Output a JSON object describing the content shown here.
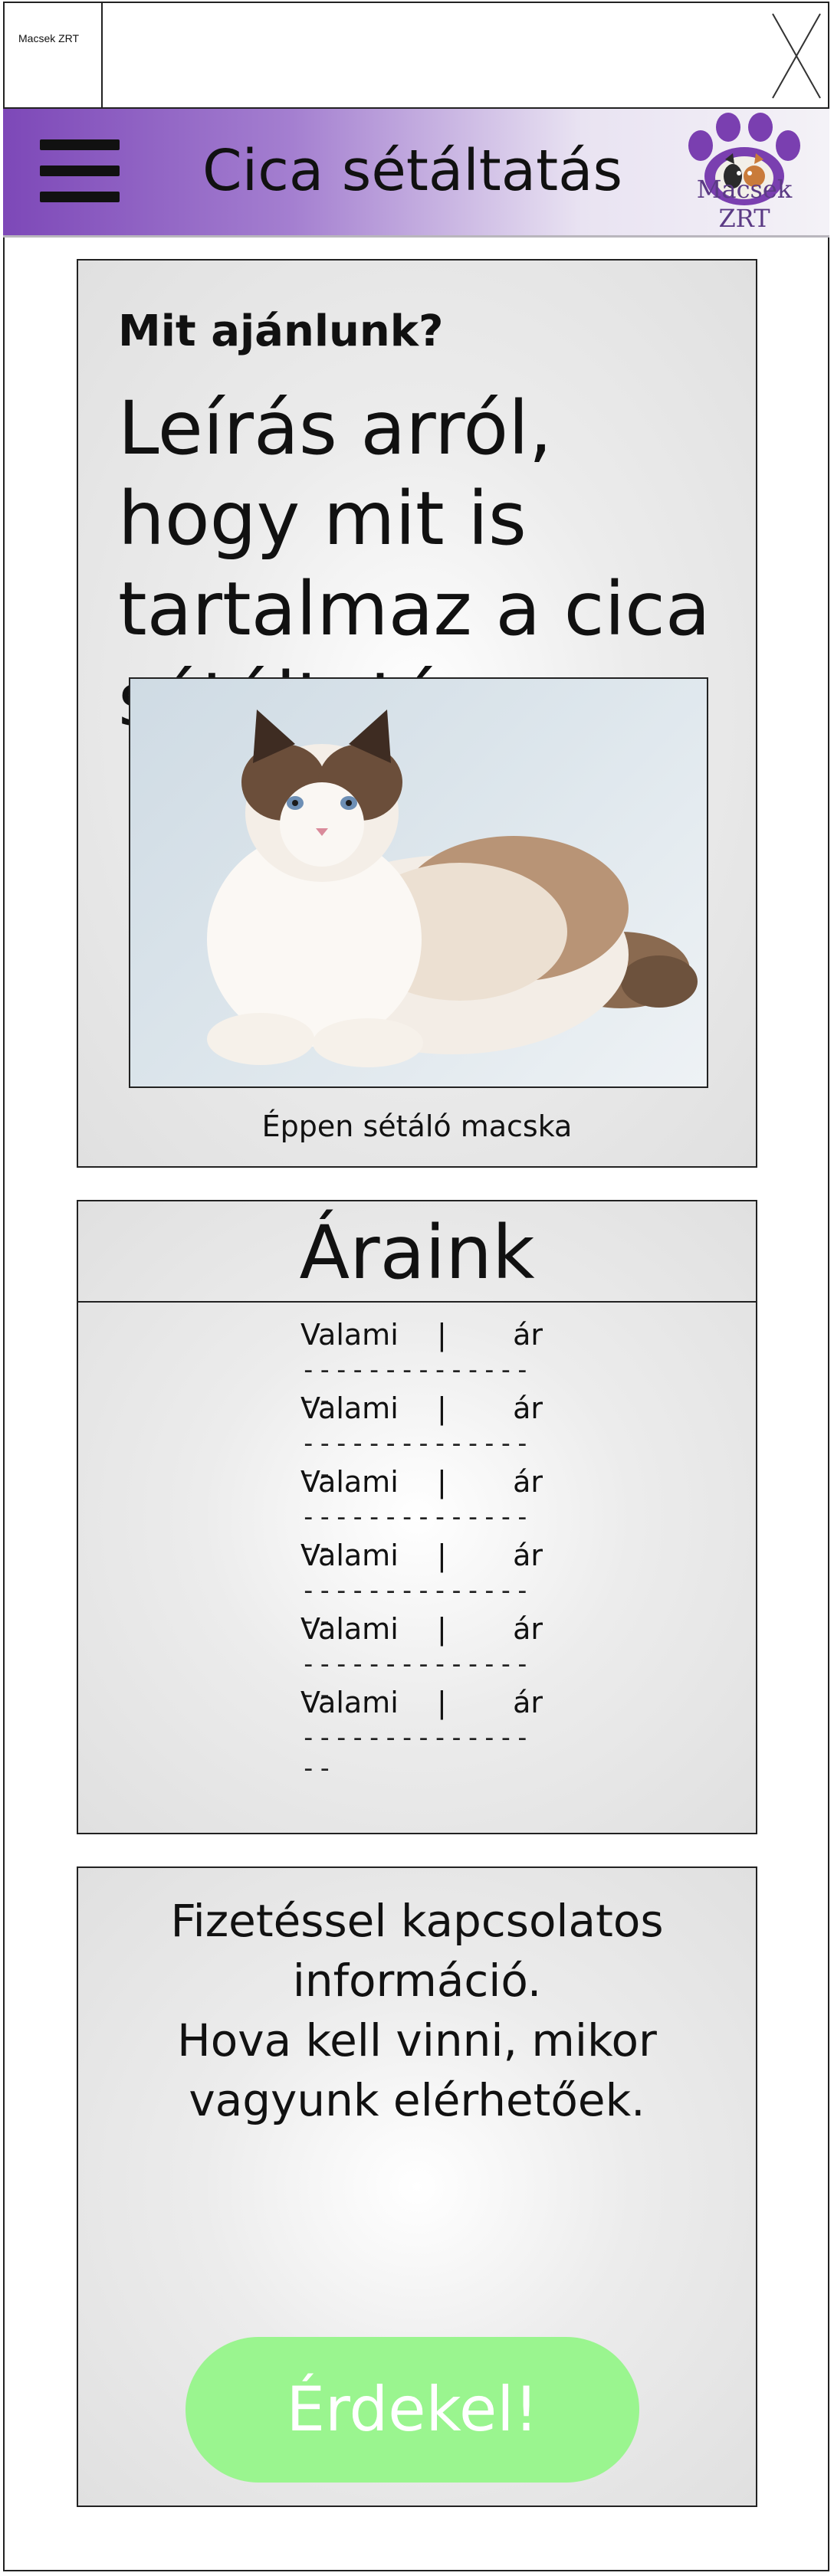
{
  "topbar": {
    "tab_label": "Macsek ZRT"
  },
  "header": {
    "title": "Cica sétáltatás",
    "logo_text": "Macsek ZRT"
  },
  "offer": {
    "heading": "Mit ajánlunk?",
    "description": "Leírás arról, hogy mit is tartalmaz a cica sétáltatás",
    "caption": "Éppen sétáló macska"
  },
  "prices": {
    "title": "Áraink",
    "rows": [
      {
        "name": "Valami",
        "sep": "|",
        "value": "ár",
        "dash": "----------------"
      },
      {
        "name": "Valami",
        "sep": "|",
        "value": "ár",
        "dash": "----------------"
      },
      {
        "name": "Valami",
        "sep": "|",
        "value": "ár",
        "dash": "----------------"
      },
      {
        "name": "Valami",
        "sep": "|",
        "value": "ár",
        "dash": "----------------"
      },
      {
        "name": "Valami",
        "sep": "|",
        "value": "ár",
        "dash": "----------------"
      },
      {
        "name": "Valami",
        "sep": "|",
        "value": "ár",
        "dash": "----------------"
      }
    ]
  },
  "payment": {
    "line1": "Fizetéssel kapcsolatos",
    "line2": "információ.",
    "line3": "Hova kell vinni, mikor",
    "line4": "vagyunk elérhetőek.",
    "cta_label": "Érdekel!"
  },
  "colors": {
    "header_purple": "#7d48b8",
    "cta_green": "#9af58f"
  },
  "icons": {
    "menu": "hamburger-menu-icon",
    "close": "close-icon",
    "logo": "paw-logo"
  }
}
